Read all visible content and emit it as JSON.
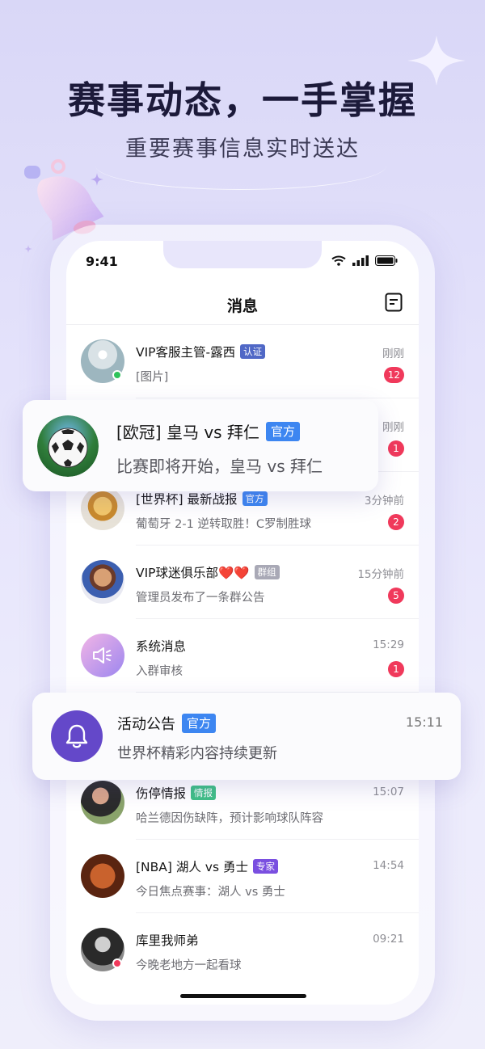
{
  "promo": {
    "headline": "赛事动态，一手掌握",
    "subline": "重要赛事信息实时送达"
  },
  "status_bar": {
    "time": "9:41"
  },
  "nav": {
    "title": "消息"
  },
  "rows": [
    {
      "name": "VIP客服主管-露西",
      "tag": "认证",
      "msg": "[图片]",
      "time": "刚刚",
      "badge": "12"
    },
    {
      "name": "",
      "tag": "",
      "msg": "",
      "time": "刚刚",
      "badge": "1"
    },
    {
      "name": "[世界杯] 最新战报",
      "tag": "官方",
      "msg": "葡萄牙 2-1 逆转取胜！C罗制胜球",
      "time": "3分钟前",
      "badge": "2"
    },
    {
      "name": "VIP球迷俱乐部❤️❤️",
      "tag": "群组",
      "msg": "管理员发布了一条群公告",
      "time": "15分钟前",
      "badge": "5"
    },
    {
      "name": "系统消息",
      "tag": "",
      "msg": "入群审核",
      "time": "15:29",
      "badge": "1"
    },
    {
      "name": "",
      "tag": "",
      "msg": "",
      "time": "",
      "badge": ""
    },
    {
      "name": "伤停情报",
      "tag": "情报",
      "msg": "哈兰德因伤缺阵，预计影响球队阵容",
      "time": "15:07",
      "badge": ""
    },
    {
      "name": "[NBA] 湖人 vs 勇士",
      "tag": "专家",
      "msg": "今日焦点赛事：湖人 vs 勇士",
      "time": "14:54",
      "badge": ""
    },
    {
      "name": "库里我师弟",
      "tag": "",
      "msg": "今晚老地方一起看球",
      "time": "09:21",
      "badge": ""
    }
  ],
  "card_match": {
    "title": "[欧冠] 皇马 vs 拜仁",
    "tag": "官方",
    "msg": "比赛即将开始，皇马 vs 拜仁"
  },
  "card_activity": {
    "title": "活动公告",
    "tag": "官方",
    "msg": "世界杯精彩内容持续更新",
    "time": "15:11"
  },
  "colors": {
    "accent_purple": "#6448c9",
    "badge_red": "#f0395b",
    "tag_blue": "#3d86f1",
    "tag_indigo": "#5068c6",
    "tag_grey": "#a9a9b6",
    "tag_green": "#3fbf86",
    "tag_violet": "#7a4fe0"
  },
  "icons": [
    "wifi-icon",
    "signal-icon",
    "battery-icon",
    "notes-icon",
    "speaker-icon",
    "bell-icon",
    "star-decoration",
    "bell-decoration"
  ]
}
